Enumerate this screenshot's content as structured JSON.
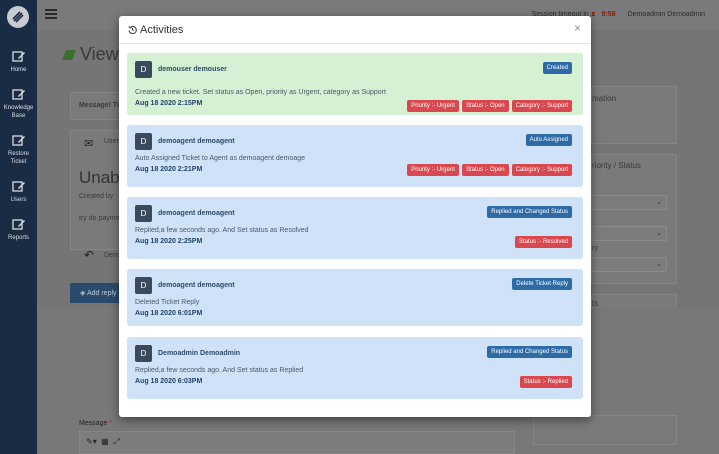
{
  "sidebar": {
    "items": [
      {
        "label": "Home",
        "icon": "edit-icon"
      },
      {
        "label": "Knowledge Base",
        "icon": "edit-icon"
      },
      {
        "label": "Restore Ticket",
        "icon": "edit-icon"
      },
      {
        "label": "Users",
        "icon": "edit-icon"
      },
      {
        "label": "Reports",
        "icon": "edit-icon"
      }
    ]
  },
  "topbar": {
    "session_label": "Session timeout in",
    "timer": "9:58",
    "user_name": "Demoadmin Demoadmin"
  },
  "background": {
    "page_title": "View",
    "message_text": "Message! Ti",
    "user_tab": "User",
    "ticket_title_fragment": "Unabl",
    "created_by": "Created by",
    "ticket_body_fragment": "try do payme",
    "reply_fragment": "Dem",
    "add_reply_tab": "Add reply",
    "right_info_fragment": "mation",
    "right_priority_fragment": "riority / Status",
    "right_category_fragment": "ry",
    "right_bottom_fragment": "ts",
    "message_label": "Message",
    "required_mark": "*"
  },
  "modal": {
    "title": "Activities",
    "close_glyph": "×",
    "activities": [
      {
        "avatar": "D",
        "name": "demouser demouser",
        "type": "Created",
        "description": "Created a new ticket. Set status as Open, priority as Urgent, category as Support",
        "date": "Aug 18 2020 2:15PM",
        "tags": [
          "Priority :- Urgent",
          "Status :- Open",
          "Category :- Support"
        ],
        "color": "#d5f0d3"
      },
      {
        "avatar": "D",
        "name": "demoagent demoagent",
        "type": "Auto Assigned",
        "description": "Auto Assigned Ticket to Agent as demoagent demoage",
        "date": "Aug 18 2020 2:21PM",
        "tags": [
          "Priority :- Urgent",
          "Status :- Open",
          "Category :- Support"
        ],
        "color": "#cfe2f7"
      },
      {
        "avatar": "D",
        "name": "demoagent demoagent",
        "type": "Replied and Changed Status",
        "description": "Replied,a few seconds ago. And Set status as Resolved",
        "date": "Aug 18 2020 2:25PM",
        "tags": [
          "Status :- Resolved"
        ],
        "color": "#cfe2f7"
      },
      {
        "avatar": "D",
        "name": "demoagent demoagent",
        "type": "Delete Ticket Reply",
        "description": "Deleted Ticket Reply",
        "date": "Aug 18 2020 6:01PM",
        "tags": [],
        "color": "#cfe2f7"
      },
      {
        "avatar": "D",
        "name": "Demoadmin Demoadmin",
        "type": "Replied and Changed Status",
        "description": "Replied,a few seconds ago. And Set status as Replied",
        "date": "Aug 18 2020 6:03PM",
        "tags": [
          "Status :- Replied"
        ],
        "color": "#cfe2f7"
      }
    ]
  }
}
